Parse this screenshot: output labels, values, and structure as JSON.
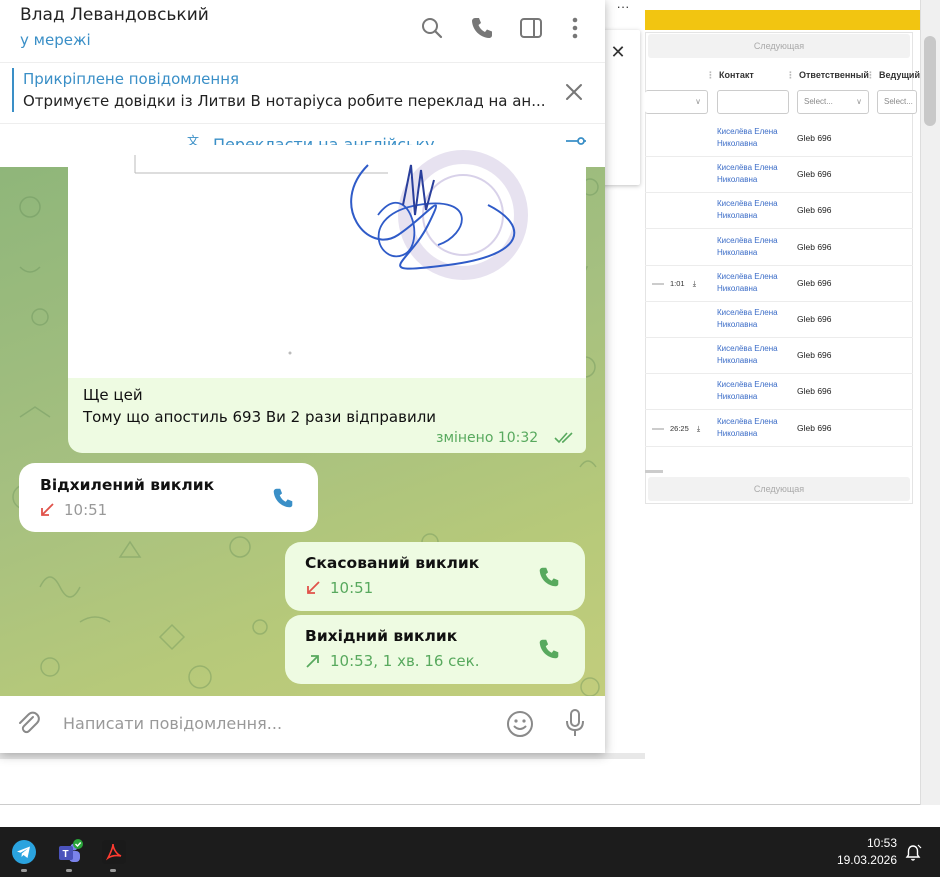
{
  "background_app": {
    "pager_label": "Следующая",
    "columns": [
      "Контакт",
      "Ответственный",
      "Ведущий"
    ],
    "filter_placeholder": "Select...",
    "filter_placeholder_short": "Select...",
    "rows": [
      {
        "contact": "Киселёва Елена Николавна",
        "responsible": "Gleb 696"
      },
      {
        "contact": "Киселёва Елена Николавна",
        "responsible": "Gleb 696"
      },
      {
        "contact": "Киселёва Елена Николавна",
        "responsible": "Gleb 696"
      },
      {
        "contact": "Киселёва Елена Николавна",
        "responsible": "Gleb 696"
      },
      {
        "contact": "Киселёва Елена Николавна",
        "responsible": "Gleb 696",
        "audio": "1:01"
      },
      {
        "contact": "Киселёва Елена Николавна",
        "responsible": "Gleb 696"
      },
      {
        "contact": "Киселёва Елена Николавна",
        "responsible": "Gleb 696"
      },
      {
        "contact": "Киселёва Елена Николавна",
        "responsible": "Gleb 696"
      },
      {
        "contact": "Киселёва Елена Николавна",
        "responsible": "Gleb 696",
        "audio": "26:25"
      }
    ],
    "menu_dots": "···",
    "close_glyph": "✕"
  },
  "telegram": {
    "contact_name": "Влад Левандовський",
    "contact_status": "у мережі",
    "header_icons": [
      "search-icon",
      "phone-icon",
      "sidebar-toggle-icon",
      "more-vertical-icon"
    ],
    "pinned": {
      "title": "Прикріплене повідомлення",
      "text": "Отримуєте довідки із Литви В нотаріуса робите переклад на ан..."
    },
    "translate_label": "Перекласти на англійську",
    "messages": {
      "image_caption_line1": "Ще цей",
      "image_caption_line2": "Тому що апостиль 693 Ви 2 рази відправили",
      "image_meta": "змінено 10:32"
    },
    "calls": [
      {
        "title": "Відхилений виклик",
        "meta": "10:51",
        "direction": "missed"
      },
      {
        "title": "Скасований виклик",
        "meta": "10:51",
        "direction": "missed"
      },
      {
        "title": "Вихідний виклик",
        "meta": "10:53, 1 хв. 16 сек.",
        "direction": "outgoing"
      }
    ],
    "composer_placeholder": "Написати повідомлення...",
    "colors": {
      "accent": "#3a8fc7",
      "outgoing_bubble": "#eefbe2",
      "outgoing_meta": "#58a95e",
      "missed": "#e0524a"
    }
  },
  "taskbar": {
    "apps": [
      "telegram-icon",
      "teams-icon",
      "acrobat-icon"
    ],
    "time": "10:53",
    "date": "19.03.2026"
  }
}
